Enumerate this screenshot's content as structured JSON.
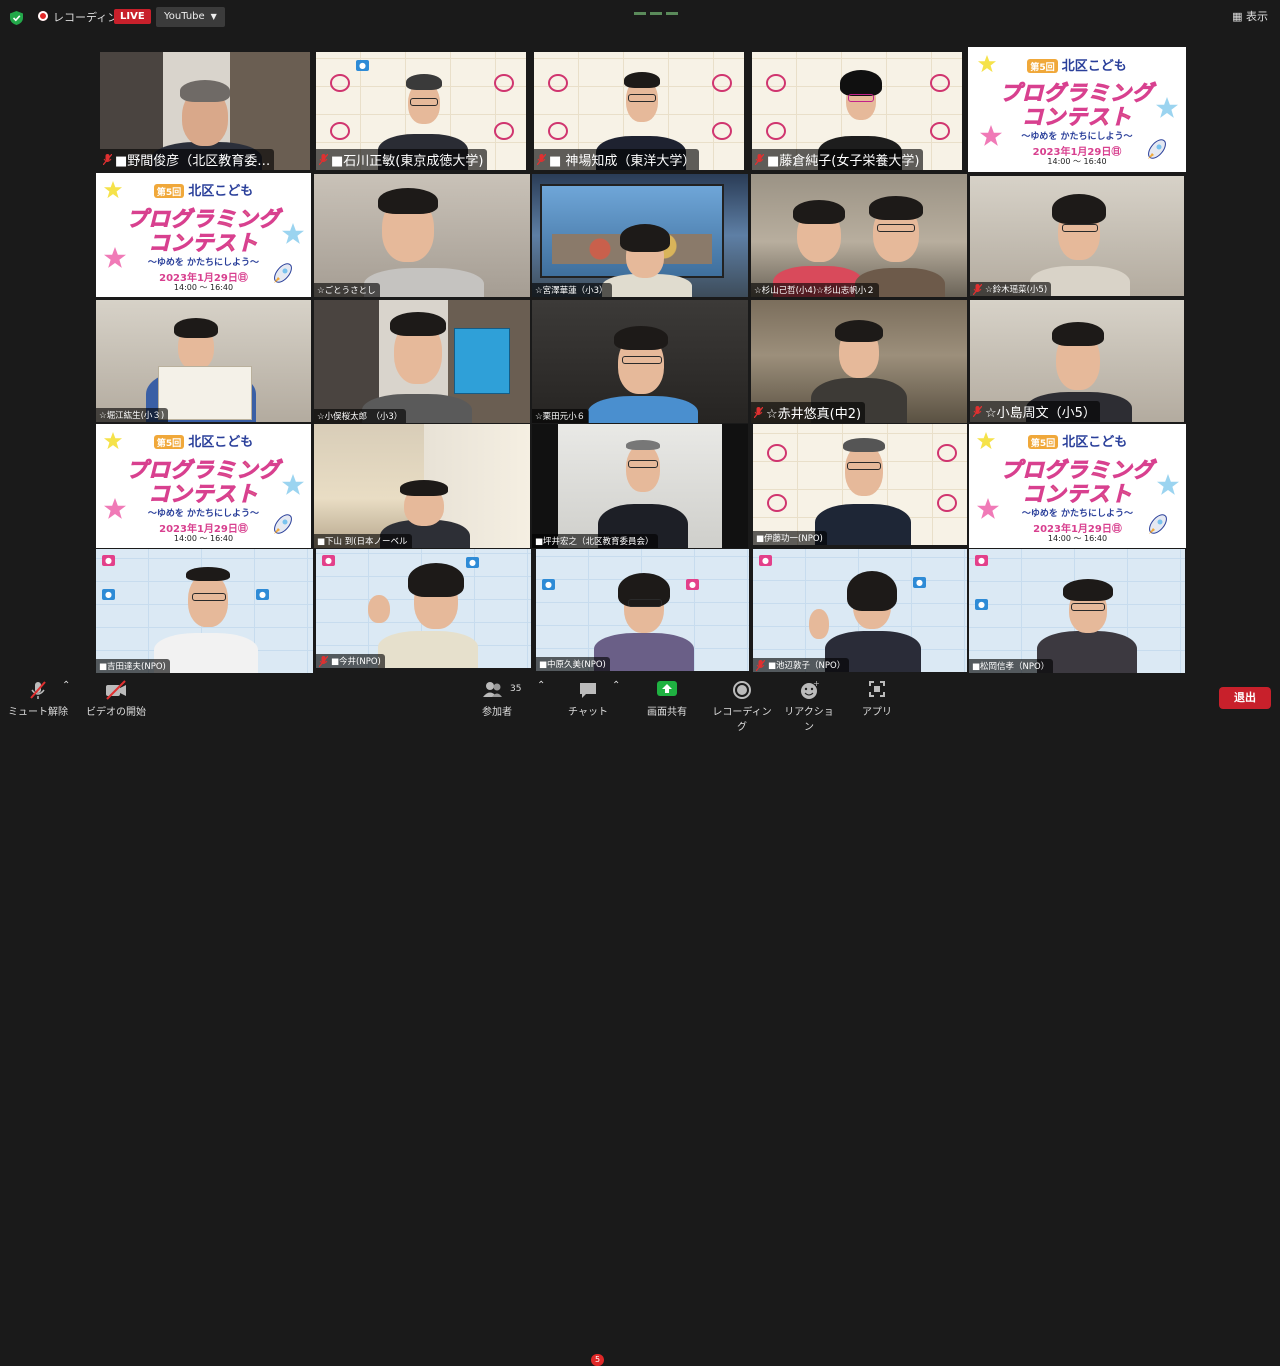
{
  "topbar": {
    "recording_label": "レコーディング",
    "live_label": "LIVE",
    "stream_target": "YouTube",
    "view_label": "表示"
  },
  "banner": {
    "edition": "第5回",
    "org": "北区こども",
    "title_line1": "プログラミング",
    "title_line2": "コンテスト",
    "tagline": "〜ゆめを かたちにしよう〜",
    "date": "2023年1月29日㊐",
    "time": "14:00 〜 16:40"
  },
  "participants": [
    {
      "name": "■野間俊彦（北区教育委…",
      "muted": true
    },
    {
      "name": "■石川正敏(東京成徳大学)",
      "muted": true
    },
    {
      "name": "■ 神場知成（東洋大学）",
      "muted": true
    },
    {
      "name": "■藤倉純子(女子栄養大学)",
      "muted": true
    },
    {
      "name": "",
      "muted": false
    },
    {
      "name": "",
      "muted": false
    },
    {
      "name": "☆ごとうさとし",
      "muted": false
    },
    {
      "name": "☆宮澤華蓮（小3）",
      "muted": false
    },
    {
      "name": "☆杉山己哲(小4)☆杉山志帆小２",
      "muted": false
    },
    {
      "name": "☆鈴木瑶菜(小5)",
      "muted": true
    },
    {
      "name": "☆堀江紘生(小３)",
      "muted": false
    },
    {
      "name": "☆小俣桜太郎　（小3）",
      "muted": false
    },
    {
      "name": "☆栗田元小６",
      "muted": false
    },
    {
      "name": "☆赤井悠真(中2)",
      "muted": true
    },
    {
      "name": "☆小島周文（小5）",
      "muted": true
    },
    {
      "name": "",
      "muted": false
    },
    {
      "name": "■下山 到(日本ノーベル",
      "muted": false
    },
    {
      "name": "■坪井宏之（北区教育委員会）",
      "muted": false
    },
    {
      "name": "■伊藤功一(NPO)",
      "muted": false
    },
    {
      "name": "",
      "muted": false
    },
    {
      "name": "■吉田達夫(NPO)",
      "muted": false
    },
    {
      "name": "■今井(NPO)",
      "muted": true
    },
    {
      "name": "■中原久美(NPO)",
      "muted": false
    },
    {
      "name": "■池辺敦子（NPO）",
      "muted": true
    },
    {
      "name": "■松岡信孝（NPO）",
      "muted": false
    }
  ],
  "toolbar": {
    "mute_label": "ミュート解除",
    "video_label": "ビデオの開始",
    "participants_label": "参加者",
    "participants_count": "35",
    "chat_label": "チャット",
    "chat_badge": "5",
    "share_label": "画面共有",
    "record_label": "レコーディング",
    "reactions_label": "リアクション",
    "apps_label": "アプリ",
    "leave_label": "退出"
  },
  "colors": {
    "background": "#1a1a1a",
    "live_red": "#c8202b",
    "share_green": "#1fb141",
    "banner_pink": "#d8408f",
    "banner_blue": "#2a3f9a"
  }
}
